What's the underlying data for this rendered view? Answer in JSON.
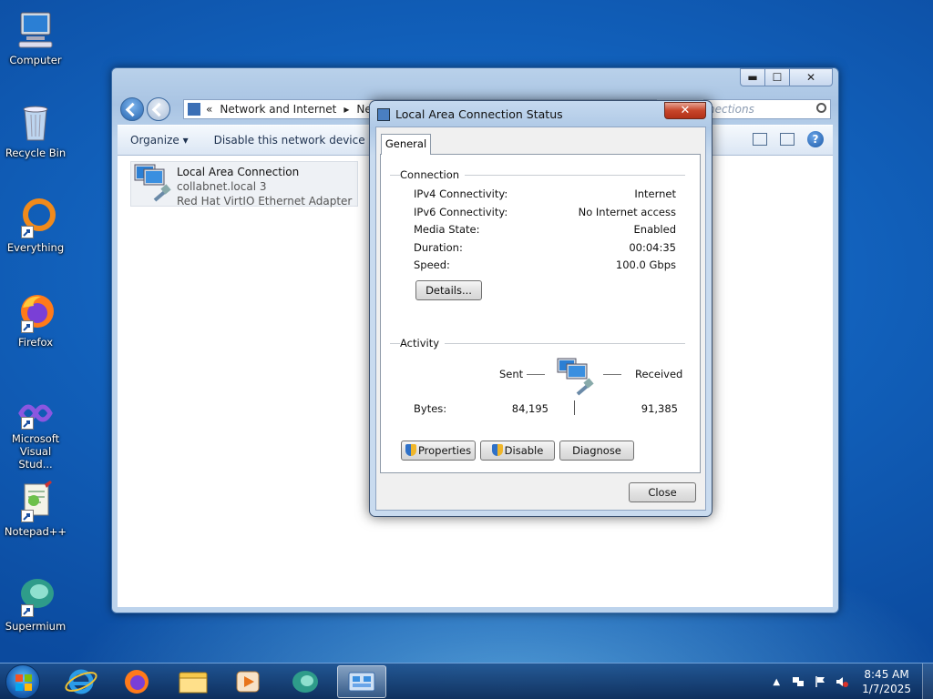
{
  "desktop_icons": [
    {
      "label": "Computer",
      "icon": "computer-icon"
    },
    {
      "label": "Recycle Bin",
      "icon": "recycle-bin-icon"
    },
    {
      "label": "Everything",
      "icon": "everything-icon"
    },
    {
      "label": "Firefox",
      "icon": "firefox-icon"
    },
    {
      "label": "Microsoft Visual Stud...",
      "icon": "visual-studio-icon"
    },
    {
      "label": "Notepad++",
      "icon": "notepadpp-icon"
    },
    {
      "label": "Supermium",
      "icon": "supermium-icon"
    }
  ],
  "explorer": {
    "breadcrumb_prefix": "«",
    "breadcrumb": [
      "Network and Internet",
      "Netw"
    ],
    "search_placeholder": "nections",
    "cmd": {
      "organize": "Organize ▾",
      "disable": "Disable this network device"
    },
    "item": {
      "name": "Local Area Connection",
      "network": "collabnet.local  3",
      "adapter": "Red Hat VirtIO Ethernet Adapter"
    }
  },
  "dialog": {
    "title": "Local Area Connection Status",
    "tab": "General",
    "connection_label": "Connection",
    "rows": [
      {
        "label": "IPv4 Connectivity:",
        "value": "Internet"
      },
      {
        "label": "IPv6 Connectivity:",
        "value": "No Internet access"
      },
      {
        "label": "Media State:",
        "value": "Enabled"
      },
      {
        "label": "Duration:",
        "value": "00:04:35"
      },
      {
        "label": "Speed:",
        "value": "100.0 Gbps"
      }
    ],
    "details_button": "Details...",
    "activity_label": "Activity",
    "sent_label": "Sent",
    "received_label": "Received",
    "bytes_label": "Bytes:",
    "bytes_sent": "84,195",
    "bytes_received": "91,385",
    "properties_button": "Properties",
    "disable_button": "Disable",
    "diagnose_button": "Diagnose",
    "close_button": "Close"
  },
  "taskbar": {
    "time": "8:45 AM",
    "date": "1/7/2025"
  },
  "colors": {
    "desktop": "#1262bd",
    "dialog_close": "#c7452a"
  }
}
